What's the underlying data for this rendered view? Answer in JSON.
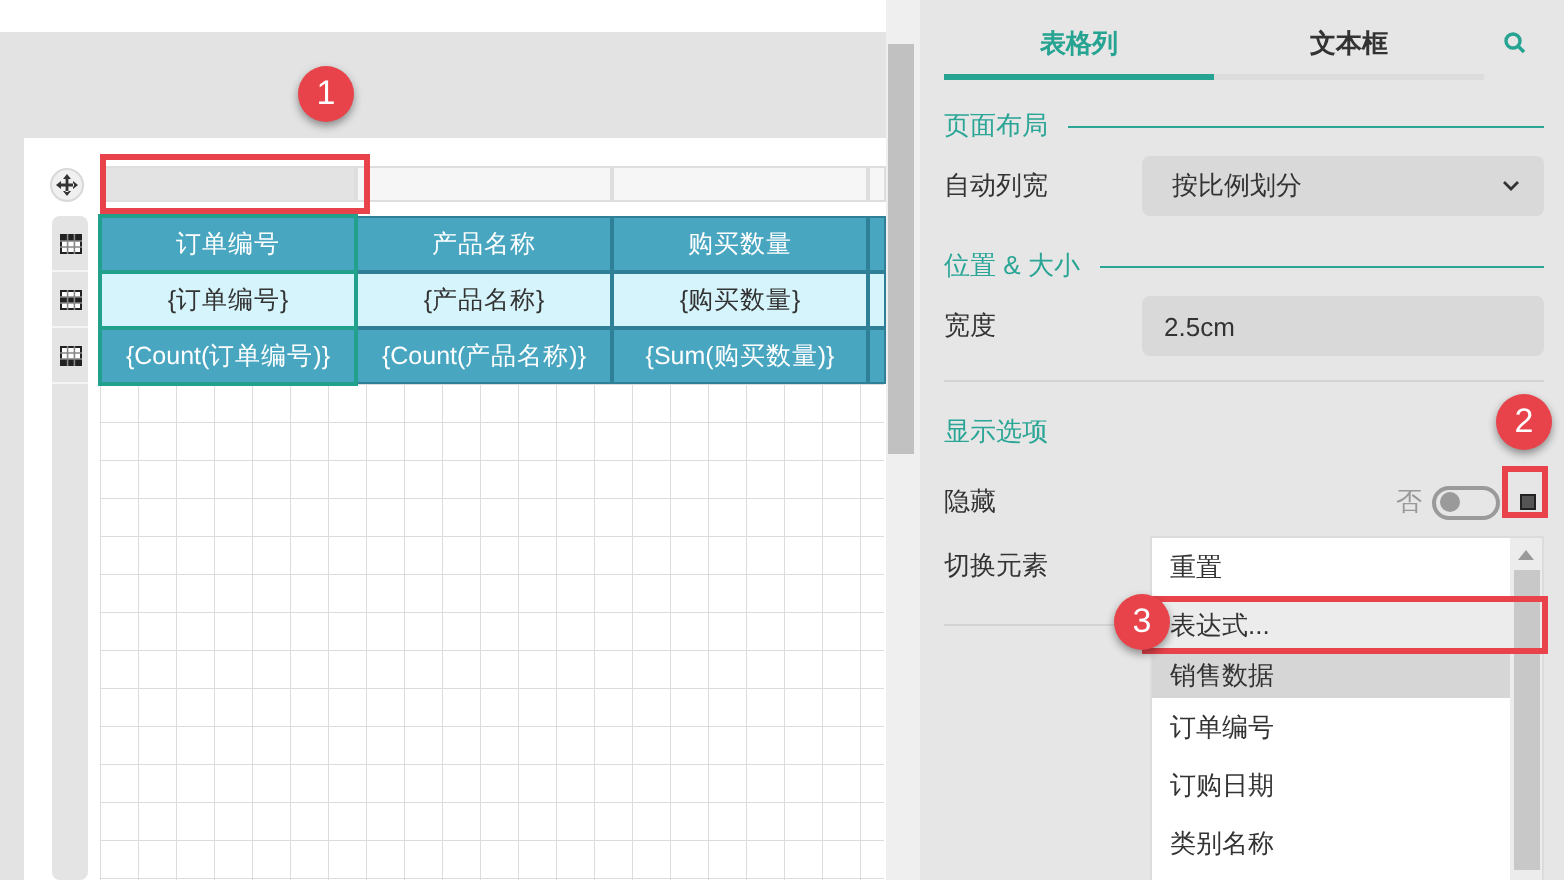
{
  "table": {
    "columns": [
      {
        "header": "订单编号",
        "detail": "{订单编号}",
        "footer": "{Count(订单编号)}",
        "selected": true
      },
      {
        "header": "产品名称",
        "detail": "{产品名称}",
        "footer": "{Count(产品名称)}",
        "selected": false
      },
      {
        "header": "购买数量",
        "detail": "{购买数量}",
        "footer": "{Sum(购买数量)}",
        "selected": false
      }
    ]
  },
  "tabs": [
    {
      "label": "表格列",
      "selected": true
    },
    {
      "label": "文本框",
      "selected": false
    }
  ],
  "sections": [
    {
      "title": "页面布局",
      "kind": "ruled",
      "fields": [
        {
          "kind": "select",
          "label": "自动列宽",
          "value": "按比例划分"
        }
      ]
    },
    {
      "title": "位置 & 大小",
      "kind": "ruled",
      "fields": [
        {
          "kind": "text",
          "label": "宽度",
          "value": "2.5cm"
        }
      ]
    },
    {
      "title": "显示选项",
      "kind": "separated",
      "fields": [
        {
          "kind": "toggle",
          "label": "隐藏",
          "state_text": "否",
          "on": false
        },
        {
          "kind": "list",
          "label": "切换元素",
          "items": [
            {
              "label": "重置",
              "kind": "option",
              "highlighted": false
            },
            {
              "label": "表达式...",
              "kind": "option",
              "highlighted": true
            },
            {
              "label": "销售数据",
              "kind": "group",
              "highlighted": false
            },
            {
              "label": "订单编号",
              "kind": "option",
              "highlighted": false
            },
            {
              "label": "订购日期",
              "kind": "option",
              "highlighted": false
            },
            {
              "label": "类别名称",
              "kind": "option",
              "highlighted": false
            }
          ]
        }
      ]
    }
  ],
  "callouts": [
    {
      "number": "1"
    },
    {
      "number": "2"
    },
    {
      "number": "3"
    }
  ]
}
